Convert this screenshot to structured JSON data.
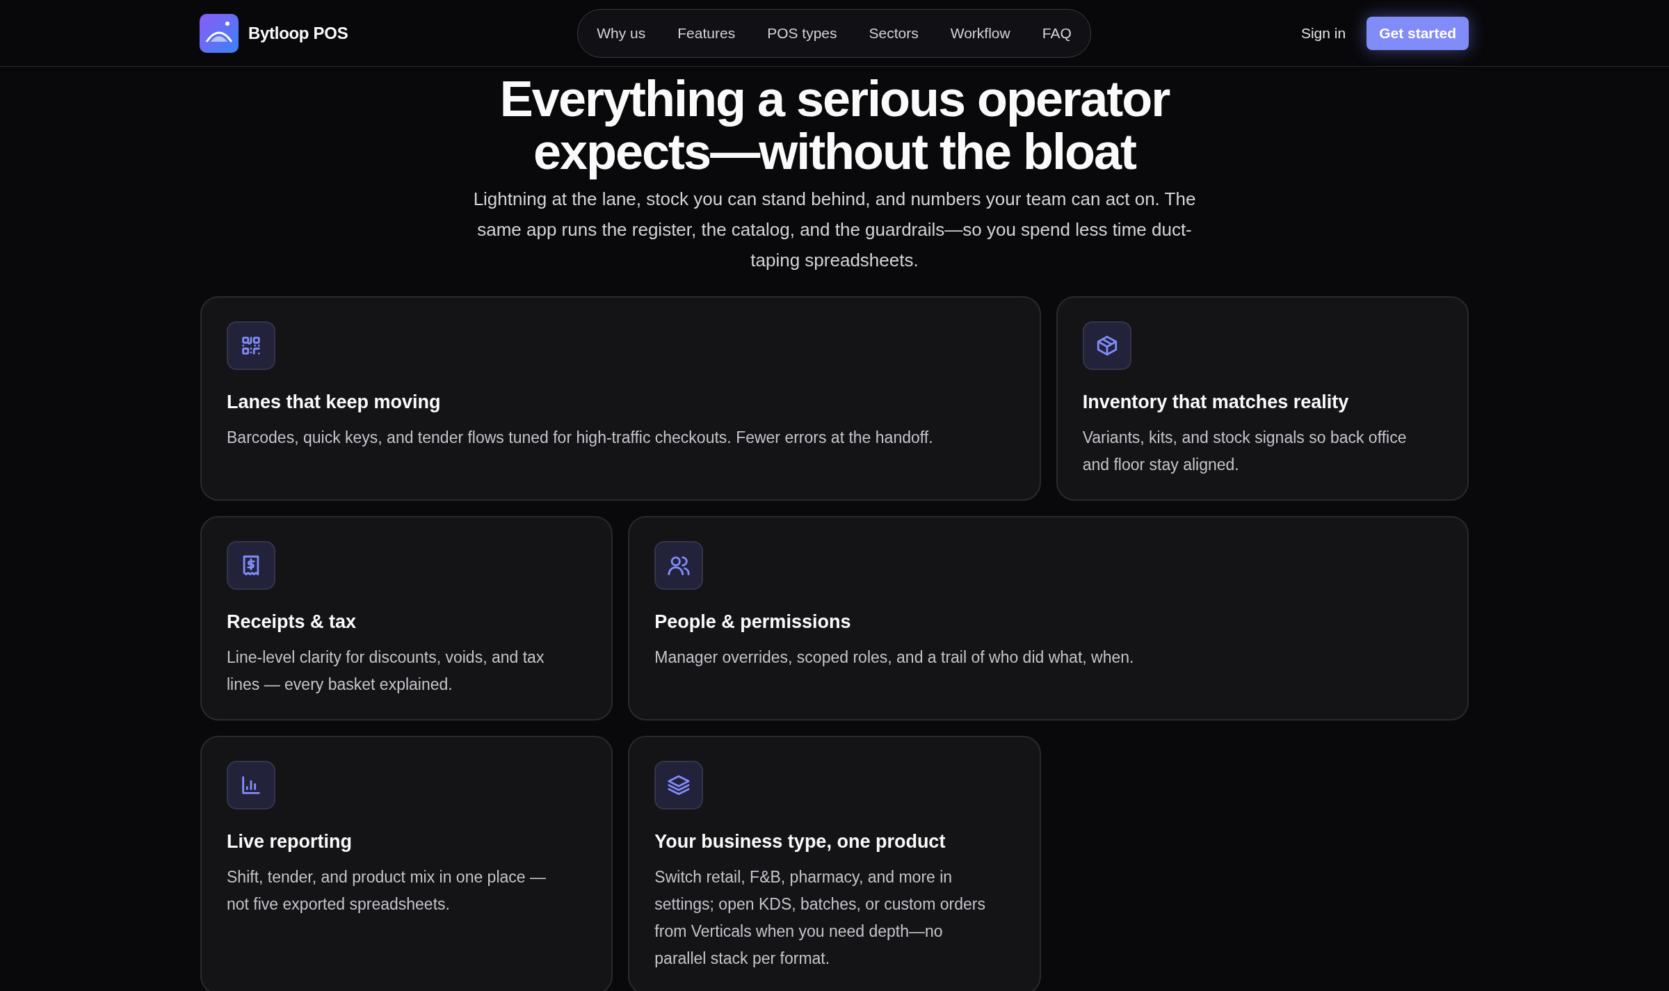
{
  "header": {
    "brand": "Bytloop POS",
    "nav": [
      {
        "label": "Why us"
      },
      {
        "label": "Features"
      },
      {
        "label": "POS types"
      },
      {
        "label": "Sectors"
      },
      {
        "label": "Workflow"
      },
      {
        "label": "FAQ"
      }
    ],
    "sign_in": "Sign in",
    "cta": "Get started"
  },
  "hero": {
    "title": "Everything a serious operator expects—without the bloat",
    "subtitle": "Lightning at the lane, stock you can stand behind, and numbers your team can act on. The same app runs the register, the catalog, and the guardrails—so you spend less time duct-taping spreadsheets."
  },
  "features": [
    {
      "kind": "qr",
      "title": "Lanes that keep moving",
      "text": "Barcodes, quick keys, and tender flows tuned for high-traffic checkouts. Fewer errors at the handoff."
    },
    {
      "kind": "box",
      "title": "Inventory that matches reality",
      "text": "Variants, kits, and stock signals so back office and floor stay aligned."
    },
    {
      "kind": "receipt",
      "title": "Receipts & tax",
      "text": "Line-level clarity for discounts, voids, and tax lines — every basket explained."
    },
    {
      "kind": "people",
      "title": "People & permissions",
      "text": "Manager overrides, scoped roles, and a trail of who did what, when."
    },
    {
      "kind": "chart",
      "title": "Live reporting",
      "text": "Shift, tender, and product mix in one place — not five exported spreadsheets."
    },
    {
      "kind": "layers",
      "title": "Your business type, one product",
      "text": "Switch retail, F&B, pharmacy, and more in settings; open KDS, batches, or custom orders from Verticals when you need depth—no parallel stack per format."
    }
  ]
}
